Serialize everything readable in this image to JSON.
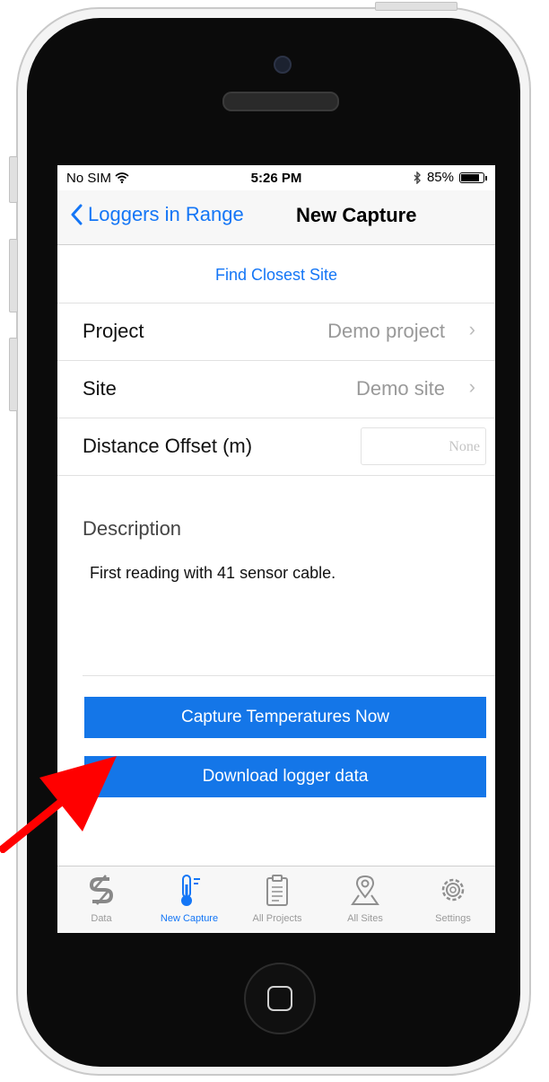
{
  "status_bar": {
    "carrier": "No SIM",
    "time": "5:26 PM",
    "battery": "85%",
    "battery_level": 0.85
  },
  "nav": {
    "back_label": "Loggers in Range",
    "title": "New Capture"
  },
  "find_link": "Find Closest Site",
  "form": {
    "project": {
      "label": "Project",
      "value": "Demo project"
    },
    "site": {
      "label": "Site",
      "value": "Demo site"
    },
    "offset": {
      "label": "Distance Offset (m)",
      "placeholder": "None"
    },
    "description": {
      "label": "Description",
      "text": "First reading with 41 sensor cable."
    }
  },
  "buttons": {
    "capture": "Capture Temperatures Now",
    "download": "Download logger data"
  },
  "tabs": [
    {
      "label": "Data",
      "icon": "data-logo-icon"
    },
    {
      "label": "New Capture",
      "icon": "thermometer-icon",
      "active": true
    },
    {
      "label": "All Projects",
      "icon": "clipboard-icon"
    },
    {
      "label": "All Sites",
      "icon": "map-pin-icon"
    },
    {
      "label": "Settings",
      "icon": "gear-icon"
    }
  ],
  "colors": {
    "accent": "#1476f6",
    "button": "#1476e8",
    "arrow": "#ff0000"
  }
}
